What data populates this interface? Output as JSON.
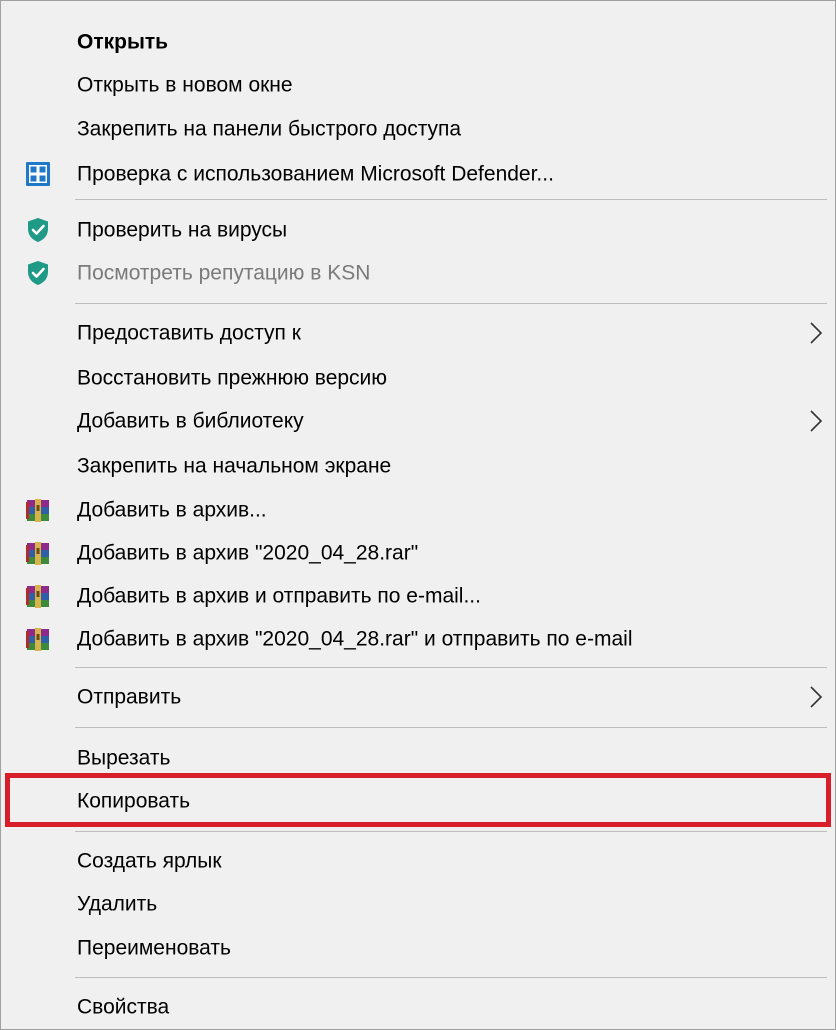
{
  "menu": {
    "items": [
      {
        "label": "Открыть"
      },
      {
        "label": "Открыть в новом окне"
      },
      {
        "label": "Закрепить на панели быстрого доступа"
      },
      {
        "label": "Проверка с использованием Microsoft Defender...",
        "icon": "microsoft-defender-icon"
      },
      {
        "label": "Проверить на вирусы",
        "icon": "kaspersky-shield-icon"
      },
      {
        "label": "Посмотреть репутацию в KSN",
        "icon": "kaspersky-shield-icon"
      },
      {
        "label": "Предоставить доступ к",
        "submenu": true
      },
      {
        "label": "Восстановить прежнюю версию"
      },
      {
        "label": "Добавить в библиотеку",
        "submenu": true
      },
      {
        "label": "Закрепить на начальном экране"
      },
      {
        "label": "Добавить в архив...",
        "icon": "winrar-icon"
      },
      {
        "label": "Добавить в архив \"2020_04_28.rar\"",
        "icon": "winrar-icon"
      },
      {
        "label": "Добавить в архив и отправить по e-mail...",
        "icon": "winrar-icon"
      },
      {
        "label": "Добавить в архив \"2020_04_28.rar\" и отправить по e-mail",
        "icon": "winrar-icon"
      },
      {
        "label": "Отправить",
        "submenu": true
      },
      {
        "label": "Вырезать"
      },
      {
        "label": "Копировать",
        "highlighted": true
      },
      {
        "label": "Создать ярлык"
      },
      {
        "label": "Удалить"
      },
      {
        "label": "Переименовать"
      },
      {
        "label": "Свойства"
      }
    ]
  },
  "colors": {
    "menu_background": "#f0f0f0",
    "separator": "#bdbdbd",
    "highlight_border": "#d81e2a",
    "disabled_text": "#7a7a7a",
    "defender_blue": "#1f78c8",
    "kaspersky_green": "#1e9a86"
  }
}
